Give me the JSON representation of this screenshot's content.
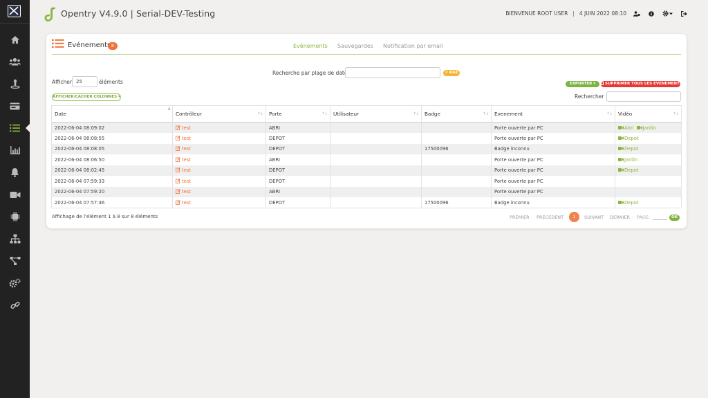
{
  "app": {
    "title": "Opentry V4.9.0 | Serial-DEV-Testing",
    "welcome": "BIENVENUE ROOT USER",
    "separator": "|",
    "date": "4 JUIN 2022 08:10"
  },
  "sidebar": {
    "items": [
      {
        "name": "home-icon"
      },
      {
        "name": "users-icon"
      },
      {
        "name": "access-point-icon"
      },
      {
        "name": "card-icon"
      },
      {
        "name": "events-list-icon"
      },
      {
        "name": "stats-icon"
      },
      {
        "name": "alarm-bell-icon"
      },
      {
        "name": "camera-icon"
      },
      {
        "name": "chip-icon"
      },
      {
        "name": "network-icon"
      },
      {
        "name": "topology-icon"
      },
      {
        "name": "settings-icon"
      },
      {
        "name": "link-icon"
      }
    ],
    "active_index": 4
  },
  "page": {
    "title": "Evénements",
    "count": "8",
    "tabs": [
      {
        "label": "Evénements",
        "active": true
      },
      {
        "label": "Sauvegardes",
        "active": false
      },
      {
        "label": "Notification par email",
        "active": false
      }
    ]
  },
  "controls": {
    "date_range_label": "Recherche par plage de date",
    "date_range_value": "",
    "reset_label": "✕ RAZ",
    "show_label": "Afficher",
    "show_value": "25",
    "show_suffix": "éléments",
    "columns_toggle": "AFFICHER/CACHER COLONNES ▾",
    "export_label": "EXPORTER ▾",
    "delete_all_label": "SUPPRIMER TOUS LES EVENEMENTS",
    "search_label": "Rechercher :",
    "search_value": ""
  },
  "table": {
    "columns": [
      "Date",
      "Contrôleur",
      "Porte",
      "Utilisateur",
      "Badge",
      "Evenement",
      "Vidéo"
    ],
    "rows": [
      {
        "date": "2022-06-04 08:09:02",
        "controller": "test",
        "door": "ABRI",
        "user": "",
        "badge": "",
        "event": "Porte ouverte par PC",
        "event_type": "ok",
        "videos": [
          "Abri",
          "Jardin"
        ]
      },
      {
        "date": "2022-06-04 08:08:55",
        "controller": "test",
        "door": "DEPOT",
        "user": "",
        "badge": "",
        "event": "Porte ouverte par PC",
        "event_type": "ok",
        "videos": [
          "Depot"
        ]
      },
      {
        "date": "2022-06-04 08:08:05",
        "controller": "test",
        "door": "DEPOT",
        "user": "",
        "badge": "17500096",
        "event": "Badge inconnu",
        "event_type": "warn",
        "videos": [
          "Depot"
        ]
      },
      {
        "date": "2022-06-04 08:06:50",
        "controller": "test",
        "door": "ABRI",
        "user": "",
        "badge": "",
        "event": "Porte ouverte par PC",
        "event_type": "ok",
        "videos": [
          "Jardin"
        ]
      },
      {
        "date": "2022-06-04 08:02:45",
        "controller": "test",
        "door": "DEPOT",
        "user": "",
        "badge": "",
        "event": "Porte ouverte par PC",
        "event_type": "ok",
        "videos": [
          "Depot"
        ]
      },
      {
        "date": "2022-06-04 07:59:33",
        "controller": "test",
        "door": "DEPOT",
        "user": "",
        "badge": "",
        "event": "Porte ouverte par PC",
        "event_type": "ok",
        "videos": []
      },
      {
        "date": "2022-06-04 07:59:20",
        "controller": "test",
        "door": "ABRI",
        "user": "",
        "badge": "",
        "event": "Porte ouverte par PC",
        "event_type": "ok",
        "videos": []
      },
      {
        "date": "2022-06-04 07:57:46",
        "controller": "test",
        "door": "DEPOT",
        "user": "",
        "badge": "17500096",
        "event": "Badge inconnu",
        "event_type": "warn",
        "videos": [
          "Depot"
        ]
      }
    ]
  },
  "footer": {
    "info": "Affichage de l'élément 1 à 8 sur 8 éléments",
    "first": "PREMIER",
    "previous": "PRECEDENT",
    "current_page": "1",
    "next": "SUIVANT",
    "last": "DERNIER",
    "page_label": "PAGE:",
    "page_value": "",
    "ok_label": "OK"
  },
  "colors": {
    "accent_green": "#8ab53f",
    "accent_orange": "#f0713c",
    "danger_red": "#e53935",
    "warning_amber": "#f0a030",
    "sidebar_bg": "#222222"
  }
}
